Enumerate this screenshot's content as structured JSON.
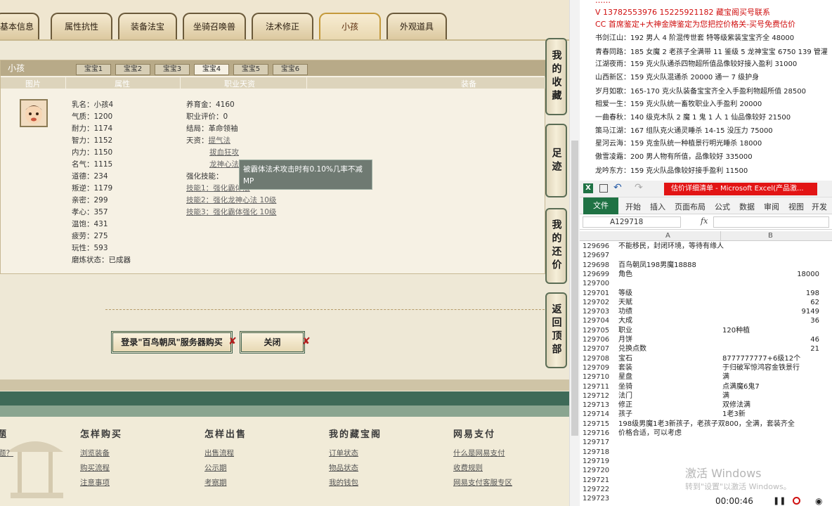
{
  "game": {
    "tabs": [
      "基本信息",
      "属性抗性",
      "装备法宝",
      "坐骑召唤兽",
      "法术修正",
      "小孩",
      "外观道具"
    ],
    "panel_title": "小孩",
    "baby_tabs": [
      "宝宝1",
      "宝宝2",
      "宝宝3",
      "宝宝4",
      "宝宝5",
      "宝宝6"
    ],
    "columns": [
      "图片",
      "属性",
      "职业天资",
      "装备"
    ],
    "attrs": [
      "乳名：小孩4",
      "气质：1200",
      "耐力：1174",
      "智力：1152",
      "内力：1150",
      "名气：1115",
      "道德：234",
      "叛逆：1179",
      "亲密：299",
      "孝心：357",
      "温饱：431",
      "疲劳：275",
      "玩性：593",
      "磨炼状态：已成器"
    ],
    "career": {
      "yangyu": "养育金：4160",
      "zhiye": "职业评价：0",
      "jieju": "结局：革命领袖",
      "tianzi_label": "天资：",
      "tianzi": [
        "提气法",
        "拔血狂攻",
        "龙神心法"
      ],
      "skill_label": "强化技能：",
      "skills": [
        "技能1：强化霸体法",
        "技能2：强化龙神心法 10级",
        "技能3：强化霸体强化 10级"
      ]
    },
    "tooltip": "被霸体法术攻击时有0.10%几率不减MP",
    "side_buttons": [
      "我的收藏",
      "足迹",
      "我的还价",
      "返回顶部"
    ],
    "buy_button": "登录\"百鸟朝凤\"服务器购买",
    "close_button": "关闭",
    "footer": {
      "col0": {
        "head": "题",
        "links": [
          "题？"
        ]
      },
      "col1": {
        "head": "怎样购买",
        "links": [
          "浏览装备",
          "购买流程",
          "注意事项"
        ]
      },
      "col2": {
        "head": "怎样出售",
        "links": [
          "出售流程",
          "公示期",
          "考察期"
        ]
      },
      "col3": {
        "head": "我的藏宝阁",
        "links": [
          "订单状态",
          "物品状态",
          "我的钱包"
        ]
      },
      "col4": {
        "head": "网易支付",
        "links": [
          "什么是网易支付",
          "收费规则",
          "网易支付客服专区"
        ]
      }
    }
  },
  "doc": {
    "line_top": "……",
    "phone": "V 13782553976    15225921182   藏宝阁买号联系",
    "promo": "CC 首席鉴定+大神金牌鉴定为您把控价格关-买号免费估价",
    "lines": [
      "书剑江山：192 男人 4 阶混传世套 特等级紫装宝宝齐全 48000",
      "青春同路：185 女魔 2 老孩子全满带 11 鉴级 5 龙神宝宝 6750 139 管灌",
      "江湖夜雨：159 克火队通杀四物超所值品像较好接入盈利 31000",
      "山西新区：159 克火队混通杀 20000 通一 7 级护身",
      "岁月如歌：165-170 克火队装备宝宝齐全入手盈利物超所值 28500",
      "相爱一生：159 克火队统一畜牧职业入手盈利 20000",
      "一曲春秋：140 级克木队 2 魔 1 鬼 1 人 1 仙品像较好 21500",
      "策马江湖：167 组队克火通灵睡杀 14-15 没压力 75000",
      "星河云海：159 克金队统一种植景行明光睡杀 18000",
      "傲雪凌霜：200 男人物有所值，品像较好 335000",
      "龙吟东方：159 克火队品像较好接手盈利 11500"
    ]
  },
  "excel": {
    "title": "估价详细清单 - Microsoft Excel(产品激...",
    "ribbon": [
      "文件",
      "开始",
      "插入",
      "页面布局",
      "公式",
      "数据",
      "审阅",
      "视图",
      "开发工"
    ],
    "name_box": "A129718",
    "fx": "fx",
    "col_a": "A",
    "col_b": "B",
    "rows": [
      {
        "n": "129696",
        "a": "不能移民，封闭环境，等待有缘人",
        "b": ""
      },
      {
        "n": "129697",
        "a": "",
        "b": ""
      },
      {
        "n": "129698",
        "a": "百鸟朝凤198男魔18888",
        "b": ""
      },
      {
        "n": "129699",
        "a": "角色",
        "b": "18000",
        "r": true
      },
      {
        "n": "129700",
        "a": "",
        "b": ""
      },
      {
        "n": "129701",
        "a": "等级",
        "b": "198",
        "r": true
      },
      {
        "n": "129702",
        "a": "天赋",
        "b": "62",
        "r": true
      },
      {
        "n": "129703",
        "a": "功绩",
        "b": "9149",
        "r": true
      },
      {
        "n": "129704",
        "a": "大成",
        "b": "36",
        "r": true
      },
      {
        "n": "129705",
        "a": "职业",
        "b": "120种植"
      },
      {
        "n": "129706",
        "a": "月饼",
        "b": "46",
        "r": true
      },
      {
        "n": "129707",
        "a": "兑换点数",
        "b": "21",
        "r": true
      },
      {
        "n": "129708",
        "a": "宝石",
        "b": "8777777777+6级12个"
      },
      {
        "n": "129709",
        "a": "套装",
        "b": "于归破军惊鸿容金铁景行"
      },
      {
        "n": "129710",
        "a": "星盘",
        "b": "满"
      },
      {
        "n": "129711",
        "a": "坐骑",
        "b": "点满魔6鬼7"
      },
      {
        "n": "129712",
        "a": "法门",
        "b": "满"
      },
      {
        "n": "129713",
        "a": "修正",
        "b": "双修法满"
      },
      {
        "n": "129714",
        "a": "孩子",
        "b": "1老3新"
      },
      {
        "n": "129715",
        "a": "198级男魔1老3新孩子，老孩子双800，全满，套装齐全",
        "b": ""
      },
      {
        "n": "129716",
        "a": "价格合适，可以考虑",
        "b": ""
      },
      {
        "n": "129717",
        "a": "",
        "b": ""
      },
      {
        "n": "129718",
        "a": "",
        "b": ""
      },
      {
        "n": "129719",
        "a": "",
        "b": ""
      },
      {
        "n": "129720",
        "a": "",
        "b": ""
      },
      {
        "n": "129721",
        "a": "",
        "b": ""
      },
      {
        "n": "129722",
        "a": "",
        "b": ""
      },
      {
        "n": "129723",
        "a": "",
        "b": ""
      }
    ]
  },
  "os": {
    "watermark": "激活 Windows",
    "watermark_sub": "转到\"设置\"以激活 Windows。",
    "rec_time": "00:00:46"
  }
}
